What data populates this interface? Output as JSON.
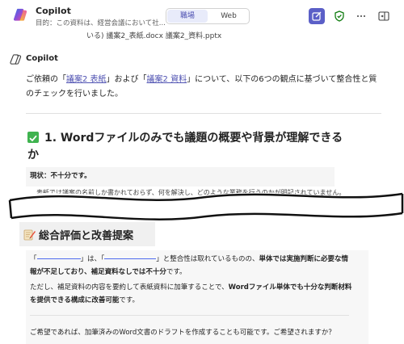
{
  "header": {
    "app_title": "Copilot",
    "subtitle": "目的：この資料は、経営会議において社...",
    "toggle_work": "職場",
    "toggle_web": "Web"
  },
  "partial_top_text": "いる) 議案2_表紙.docx 議案2_資料.pptx",
  "copilot_label": "Copilot",
  "intro": {
    "pre": "ご依頼の「",
    "link1": "議案2 表紙",
    "mid": "」および「",
    "link2": "議案2 資料",
    "post": "」について、以下の6つの観点に基づいて整合性と質のチェックを行いました。"
  },
  "section1": {
    "heading_line1": "1. Wordファイルのみでも議題の概要や背景が理解できる",
    "heading_line2": "か",
    "status": "現状：不十分です。",
    "cut_text": "…表紙では議案の名前しか書かれておらず、何を解決し、どのような業務を行うのかが明記されていません。"
  },
  "section2": {
    "heading": "総合評価と改善提案",
    "p1_a": "「",
    "p1_b": "」は、「",
    "p1_c": "」と整合性は取れているものの、",
    "p1_bold1": "単体では実施判断に必要な情報が不足しており、補足資料なしでは不十分",
    "p1_d": "です。",
    "p2_a": "ただし、補足資料の内容を要約して表紙資料に加筆することで、",
    "p2_bold": "Wordファイル単体でも十分な判断材料を提供できる構成に改善可能",
    "p2_b": "です。",
    "p3": "ご希望であれば、加筆済みのWord文書のドラフトを作成することも可能です。ご希望されますか？"
  }
}
